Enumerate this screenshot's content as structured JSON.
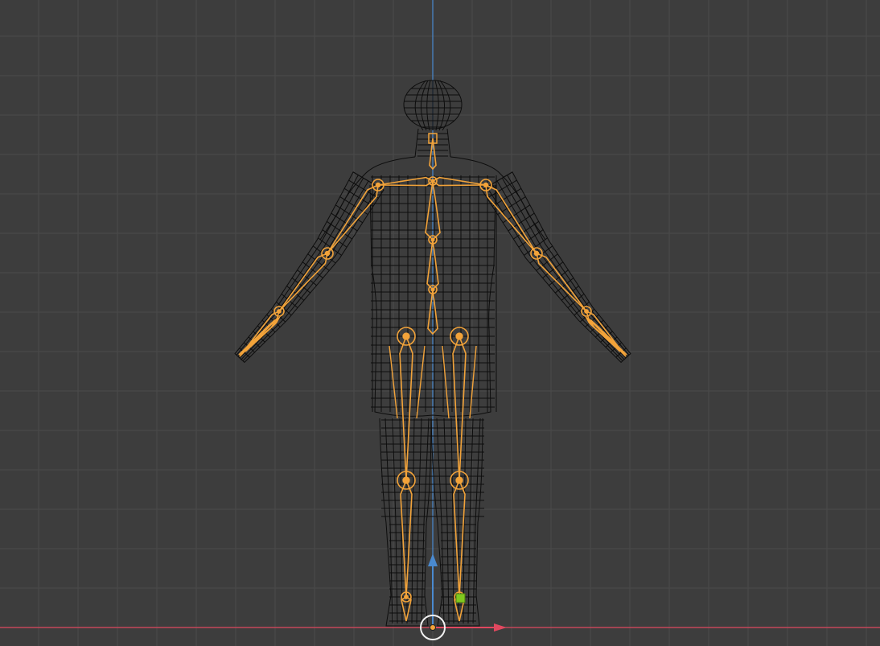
{
  "viewport": {
    "view": "front-orthographic",
    "shading": "wireframe",
    "colors": {
      "background": "#3d3d3d",
      "grid_minor": "#4a4a4a",
      "grid_major": "#535353",
      "x_axis": "#e0485f",
      "z_axis": "#4a8ad0",
      "mesh_wire": "#0d0d0d",
      "armature_selected": "#f2a33a",
      "active_bone_tip": "#7fc81f",
      "cursor": "#f0f0f0"
    },
    "objects": [
      {
        "name_visible": false,
        "type": "mesh",
        "shape": "human-figure-a-pose"
      },
      {
        "name_visible": false,
        "type": "armature",
        "state": "selected"
      }
    ],
    "gizmos": [
      "z-axis-arrow",
      "x-axis-arrow",
      "3d-cursor",
      "object-origin"
    ]
  }
}
